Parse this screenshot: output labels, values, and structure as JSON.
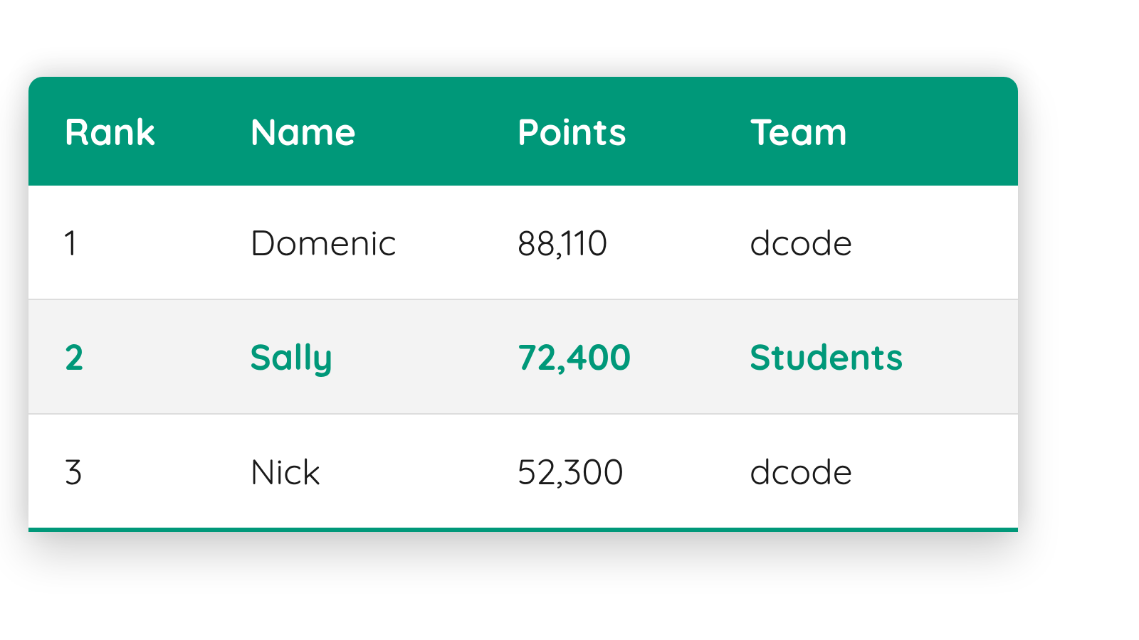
{
  "table": {
    "headers": {
      "rank": "Rank",
      "name": "Name",
      "points": "Points",
      "team": "Team"
    },
    "rows": [
      {
        "rank": "1",
        "name": "Domenic",
        "points": "88,110",
        "team": "dcode",
        "active": false
      },
      {
        "rank": "2",
        "name": "Sally",
        "points": "72,400",
        "team": "Students",
        "active": true
      },
      {
        "rank": "3",
        "name": "Nick",
        "points": "52,300",
        "team": "dcode",
        "active": false
      }
    ]
  },
  "colors": {
    "brand": "#009879"
  }
}
